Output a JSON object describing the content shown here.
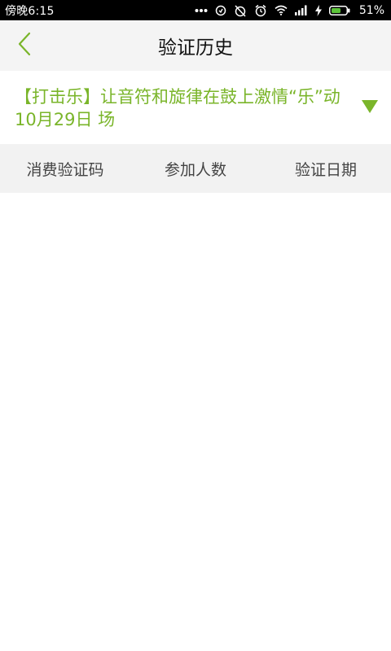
{
  "status_bar": {
    "time": "傍晚6:15",
    "battery": "51%",
    "icons": [
      "more-dots-icon",
      "sync-icon",
      "alarm-off-icon",
      "alarm-icon",
      "wifi-icon",
      "signal-icon",
      "charging-icon",
      "battery-icon"
    ]
  },
  "header": {
    "title": "验证历史",
    "back_icon": "chevron-left-icon"
  },
  "event": {
    "title": "【打击乐】让音符和旋律在鼓上激情“乐”动   10月29日 场",
    "dropdown_icon": "triangle-down-icon"
  },
  "table": {
    "columns": [
      "消费验证码",
      "参加人数",
      "验证日期"
    ],
    "rows": []
  },
  "colors": {
    "accent": "#7ab52a",
    "header_bg": "#f4f4f4",
    "table_header_bg": "#f2f2f2",
    "status_bar_bg": "#000000"
  }
}
